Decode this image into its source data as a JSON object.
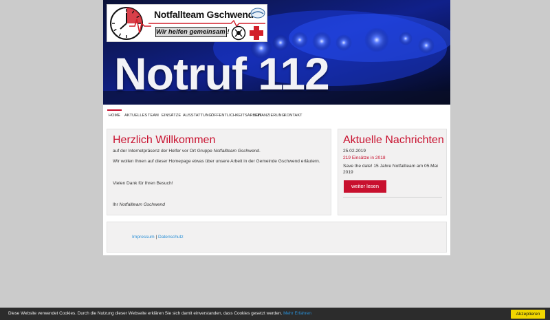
{
  "header": {
    "logo": {
      "title": "Notfallteam Gschwend",
      "slogan": "Wir helfen gemeinsam !"
    },
    "banner_text": "Notruf 112"
  },
  "nav": {
    "items": [
      {
        "label": "HOME",
        "active": true
      },
      {
        "label": "AKTUELLES"
      },
      {
        "label": "TEAM"
      },
      {
        "label": "EINSÄTZE"
      },
      {
        "label": "AUSSTATTUNG"
      },
      {
        "label": "ÖFFENTLICHKEITSARBEIT"
      },
      {
        "label": "FINANZIERUNG"
      },
      {
        "label": "KONTAKT"
      }
    ]
  },
  "welcome": {
    "title": "Herzlich Willkommen",
    "line1_prefix": "auf der Internetpräsenz der Helfer vor Ort Gruppe ",
    "line1_italic": "Notfallteam Gschwend",
    "line1_suffix": ".",
    "line2": "Wir wollen Ihnen auf dieser Homepage etwas über unsere Arbeit in der Gemeinde Gschwend erläutern.",
    "line3": "Vielen Dank für Ihren Besuch!",
    "signature_prefix": "Ihr ",
    "signature_italic": "Notfallteam Gschwend"
  },
  "news": {
    "title": "Aktuelle Nachrichten",
    "date": "25.02.2019",
    "headline": "219 Einsätze in 2018",
    "text_line1": "Save the date! 15 Jahre Notfallteam am 05.Mai",
    "text_line2": "2019",
    "button": "weiter lesen"
  },
  "footer": {
    "impressum": "Impressum",
    "separator": "|",
    "datenschutz": "Datenschutz"
  },
  "cookie": {
    "text": "Diese Website verwendet Cookies. Durch die Nutzung dieser Webseite erklären Sie sich damit einverstanden, dass Cookies gesetzt werden.",
    "link": "Mehr Erfahren",
    "button": "Akzeptieren"
  },
  "colors": {
    "accent": "#c8102e",
    "link": "#2a8fd6",
    "page_bg": "#cbcbcb",
    "box_bg": "#f2f1f1",
    "cookie_bar": "#2c2c2c",
    "cookie_button": "#f1d600"
  }
}
